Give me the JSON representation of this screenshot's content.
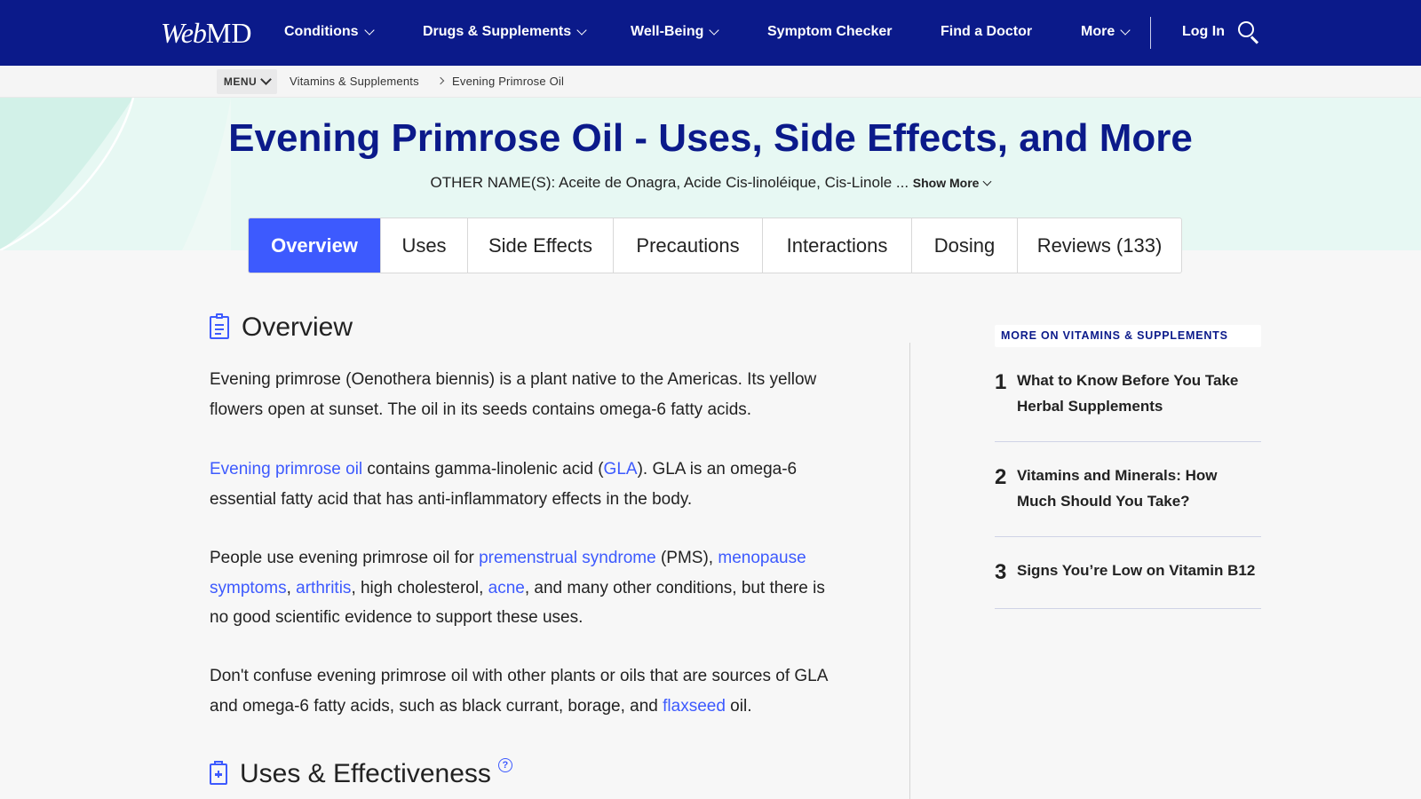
{
  "topnav": {
    "logo_main": "Web",
    "logo_suffix": "MD",
    "items": [
      {
        "label": "Conditions"
      },
      {
        "label": "Drugs & Supplements"
      },
      {
        "label": "Well-Being"
      },
      {
        "label": "Symptom Checker"
      },
      {
        "label": "Find a Doctor"
      },
      {
        "label": "More"
      }
    ],
    "login_label": "Log In",
    "search_icon": "search-icon"
  },
  "breadcrumb": {
    "menu_label": "MENU",
    "items": [
      "Vitamins & Supplements",
      "Evening Primrose Oil"
    ]
  },
  "hero": {
    "title": "Evening Primrose Oil - Uses, Side Effects, and More",
    "other_names": "OTHER NAME(S): Aceite de Onagra, Acide Cis-linoléique, Cis-Linole ...",
    "show_more": "Show More"
  },
  "tabs": [
    {
      "label": "Overview",
      "active": true
    },
    {
      "label": "Uses"
    },
    {
      "label": "Side Effects"
    },
    {
      "label": "Precautions"
    },
    {
      "label": "Interactions"
    },
    {
      "label": "Dosing"
    },
    {
      "label": "Reviews (133)"
    }
  ],
  "overview": {
    "heading": "Overview",
    "p1": "Evening primrose (Oenothera biennis) is a plant native to the Americas. Its yellow flowers open at sunset. The oil in its seeds contains omega-6 fatty acids.",
    "p2": {
      "link1": "Evening primrose oil",
      "t1": " contains gamma-linolenic acid (",
      "link2": "GLA",
      "t2": "). GLA is an omega-6 essential fatty acid that has anti-inflammatory effects in the body."
    },
    "p3": {
      "t1": "People use evening primrose oil for ",
      "link1": "premenstrual syndrome",
      "t2": " (PMS), ",
      "link2": "menopause symptoms",
      "t3": ", ",
      "link3": "arthritis",
      "t4": ", high cholesterol, ",
      "link4": "acne",
      "t5": ", and many other conditions, but there is no good scientific evidence to support these uses."
    },
    "p4": {
      "t1": "Don't confuse evening primrose oil with other plants or oils that are sources of GLA and omega-6 fatty acids, such as black currant, borage, and ",
      "link1": "flaxseed",
      "t2": " oil."
    }
  },
  "uses_section": {
    "heading": "Uses & Effectiveness",
    "help_glyph": "?"
  },
  "sidebar": {
    "heading": "MORE ON VITAMINS & SUPPLEMENTS",
    "items": [
      {
        "num": "1",
        "text": "What to Know Before You Take Herbal Supplements"
      },
      {
        "num": "2",
        "text": "Vitamins and Minerals: How Much Should You Take?"
      },
      {
        "num": "3",
        "text": "Signs You’re Low on Vitamin B12"
      }
    ]
  },
  "colors": {
    "nav_bg": "#0b1a8a",
    "accent": "#3d5afe",
    "hero_bg": "#e7f8f3"
  }
}
